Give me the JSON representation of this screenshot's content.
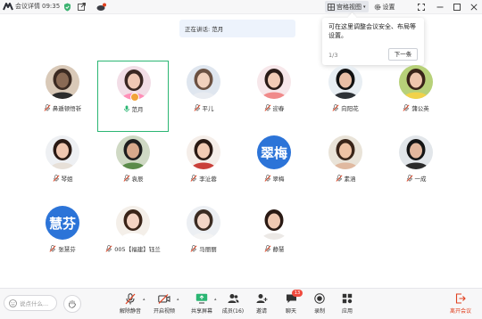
{
  "topbar": {
    "meeting_details": "会议详情",
    "time": "09:35",
    "gallery_view": "宫格视图",
    "settings": "设置"
  },
  "speaker_toast": "正在讲话: 范月",
  "tooltip": {
    "message": "可在这里调整会议安全、布局等设置。",
    "step": "1/3",
    "next_button": "下一条"
  },
  "participants": [
    {
      "name": "鼻遁顿悟祈",
      "avatar": "man-glasses",
      "mic": "muted"
    },
    {
      "name": "范月",
      "avatar": "woman-pink",
      "mic": "speaking",
      "active": true
    },
    {
      "name": "平儿",
      "avatar": "woman-light",
      "mic": "muted"
    },
    {
      "name": "迎春",
      "avatar": "woman-coral",
      "mic": "muted"
    },
    {
      "name": "向阳花",
      "avatar": "woman-dark",
      "mic": "muted"
    },
    {
      "name": "蒲公英",
      "avatar": "woman-yellow",
      "mic": "muted"
    },
    {
      "name": "琴姐",
      "avatar": "woman-smile",
      "mic": "muted"
    },
    {
      "name": "袁辰",
      "avatar": "man-green",
      "mic": "muted"
    },
    {
      "name": "李沚蓉",
      "avatar": "woman-red",
      "mic": "muted"
    },
    {
      "name": "翠梅",
      "avatar": "initials",
      "initials": "翠梅",
      "mic": "muted"
    },
    {
      "name": "素涵",
      "avatar": "woman-tan",
      "mic": "muted"
    },
    {
      "name": "一成",
      "avatar": "man-short",
      "mic": "muted"
    },
    {
      "name": "张慧芬",
      "avatar": "initials",
      "initials": "慧芬",
      "mic": "muted"
    },
    {
      "name": "005【福建】钰兰",
      "avatar": "woman-bride",
      "mic": "muted"
    },
    {
      "name": "马丽丽",
      "avatar": "woman-white",
      "mic": "muted"
    },
    {
      "name": "静慧",
      "avatar": "woman-full",
      "mic": "muted"
    }
  ],
  "toolbar": {
    "chat_placeholder": "说点什么...",
    "unmute": "解除静音",
    "start_video": "开启视频",
    "share_screen": "共享屏幕",
    "members": "成员(16)",
    "invite": "邀请",
    "chat": "聊天",
    "chat_badge": "13",
    "record": "录制",
    "apps": "应用",
    "leave": "离开会议"
  },
  "colors": {
    "accent": "#2c74d8",
    "speaking_border": "#2bb673",
    "muted_red": "#e0401f",
    "leave": "#e0401f"
  }
}
